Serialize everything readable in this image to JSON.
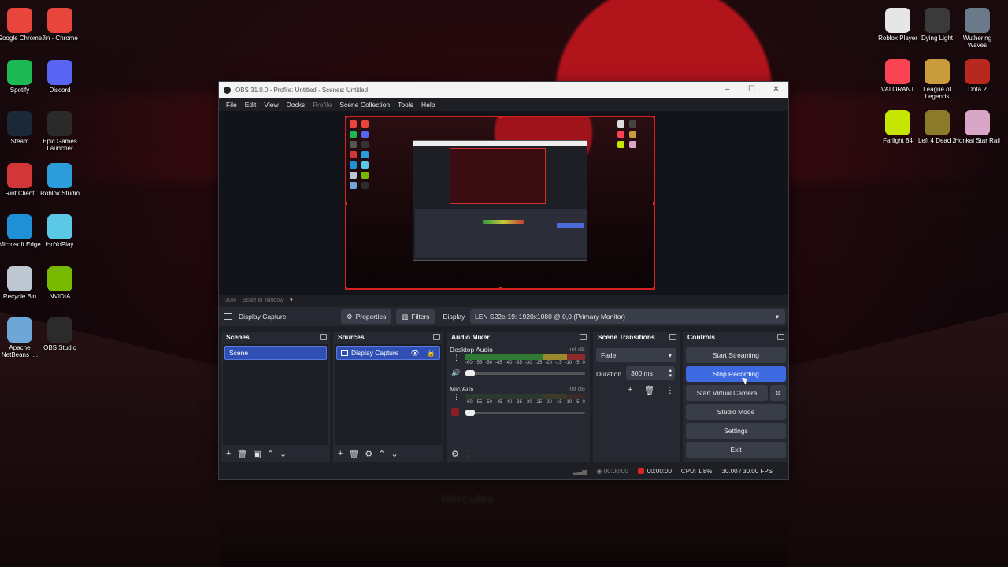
{
  "desktop": {
    "left_icons": [
      {
        "label": "Google Chrome",
        "icon": "chrome-icon",
        "color": "#e8453c"
      },
      {
        "label": "Jin - Chrome",
        "icon": "chrome-icon",
        "color": "#e8453c"
      },
      {
        "label": "Spotify",
        "icon": "spotify-icon",
        "color": "#1db954"
      },
      {
        "label": "Discord",
        "icon": "discord-icon",
        "color": "#5865f2"
      },
      {
        "label": "Steam",
        "icon": "steam-icon",
        "color": "#1b2838"
      },
      {
        "label": "Epic Games Launcher",
        "icon": "epic-games-icon",
        "color": "#2a2a2a"
      },
      {
        "label": "Riot Client",
        "icon": "riot-icon",
        "color": "#d13639"
      },
      {
        "label": "Roblox Studio",
        "icon": "roblox-studio-icon",
        "color": "#2d9cdb"
      },
      {
        "label": "Microsoft Edge",
        "icon": "edge-icon",
        "color": "#1f8fd6"
      },
      {
        "label": "HoYoPlay",
        "icon": "hoyoplay-icon",
        "color": "#5cc8e8"
      },
      {
        "label": "Recycle Bin",
        "icon": "recycle-bin-icon",
        "color": "#bfc8d2"
      },
      {
        "label": "NVIDIA",
        "icon": "nvidia-icon",
        "color": "#76b900"
      },
      {
        "label": "Apache NetBeans I...",
        "icon": "netbeans-icon",
        "color": "#6ea6d8"
      },
      {
        "label": "OBS Studio",
        "icon": "obs-icon",
        "color": "#2b2b2b"
      }
    ],
    "right_icons": [
      {
        "label": "Roblox Player",
        "icon": "roblox-icon",
        "color": "#e6e6e6"
      },
      {
        "label": "Dying Light",
        "icon": "dying-light-icon",
        "color": "#3a3a3a"
      },
      {
        "label": "Wuthering Waves",
        "icon": "wuthering-waves-icon",
        "color": "#6a7a8a"
      },
      {
        "label": "VALORANT",
        "icon": "valorant-icon",
        "color": "#fa4454"
      },
      {
        "label": "League of Legends",
        "icon": "league-icon",
        "color": "#c89b3c"
      },
      {
        "label": "Dota 2",
        "icon": "dota-icon",
        "color": "#b8281f"
      },
      {
        "label": "Farlight 84",
        "icon": "farlight-icon",
        "color": "#c6e600"
      },
      {
        "label": "Left 4 Dead 2",
        "icon": "left4dead-icon",
        "color": "#8a7a2a"
      },
      {
        "label": "Honkai Star Rail",
        "icon": "honkai-icon",
        "color": "#d9a6c8"
      }
    ],
    "blur_text": "Hercules"
  },
  "obs": {
    "title": "OBS 31.0.0 - Profile: Untitled - Scenes: Untitled",
    "menu": [
      "File",
      "Edit",
      "View",
      "Docks",
      "Profile",
      "Scene Collection",
      "Tools",
      "Help"
    ],
    "zoom": {
      "percent": "30%",
      "mode": "Scale to Window"
    },
    "source_toolbar": {
      "selected_source": "Display Capture",
      "properties": "Properties",
      "filters": "Filters",
      "display_label": "Display",
      "display_value": "LEN S22e-19: 1920x1080 @ 0,0 (Primary Monitor)"
    },
    "scenes": {
      "title": "Scenes",
      "items": [
        "Scene"
      ]
    },
    "sources": {
      "title": "Sources",
      "items": [
        "Display Capture"
      ]
    },
    "mixer": {
      "title": "Audio Mixer",
      "channels": [
        {
          "name": "Desktop Audio",
          "db": "-inf dB"
        },
        {
          "name": "Mic/Aux",
          "db": "-inf dB"
        }
      ],
      "scale": [
        "-60",
        "-55",
        "-50",
        "-45",
        "-40",
        "-35",
        "-30",
        "-25",
        "-20",
        "-15",
        "-10",
        "-5",
        "0"
      ]
    },
    "transitions": {
      "title": "Scene Transitions",
      "type": "Fade",
      "duration_label": "Duration",
      "duration_value": "300 ms"
    },
    "controls": {
      "title": "Controls",
      "start_streaming": "Start Streaming",
      "stop_recording": "Stop Recording",
      "start_virtual_camera": "Start Virtual Camera",
      "studio_mode": "Studio Mode",
      "settings": "Settings",
      "exit": "Exit",
      "accent": "#3d6ae0"
    },
    "status": {
      "stream_time": "00:00:00",
      "rec_time": "00:00:00",
      "cpu": "CPU: 1.8%",
      "fps": "30.00 / 30.00 FPS"
    }
  }
}
